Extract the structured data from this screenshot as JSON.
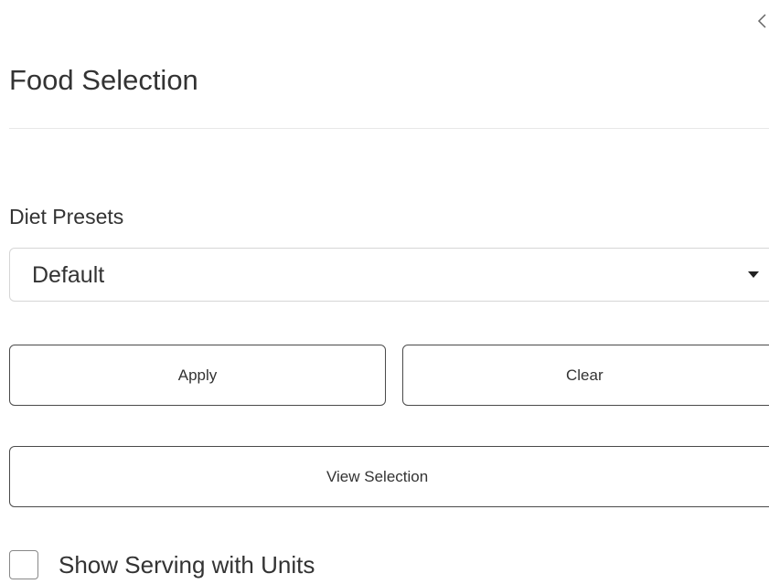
{
  "panel": {
    "title": "Food Selection",
    "collapse_icon": "chevron-left-icon"
  },
  "diet_presets": {
    "label": "Diet Presets",
    "selected": "Default",
    "dropdown_icon": "caret-down-icon"
  },
  "actions": {
    "apply_label": "Apply",
    "clear_label": "Clear",
    "view_selection_label": "View Selection"
  },
  "options": {
    "show_serving_units_label": "Show Serving with Units",
    "show_serving_units_checked": false
  }
}
